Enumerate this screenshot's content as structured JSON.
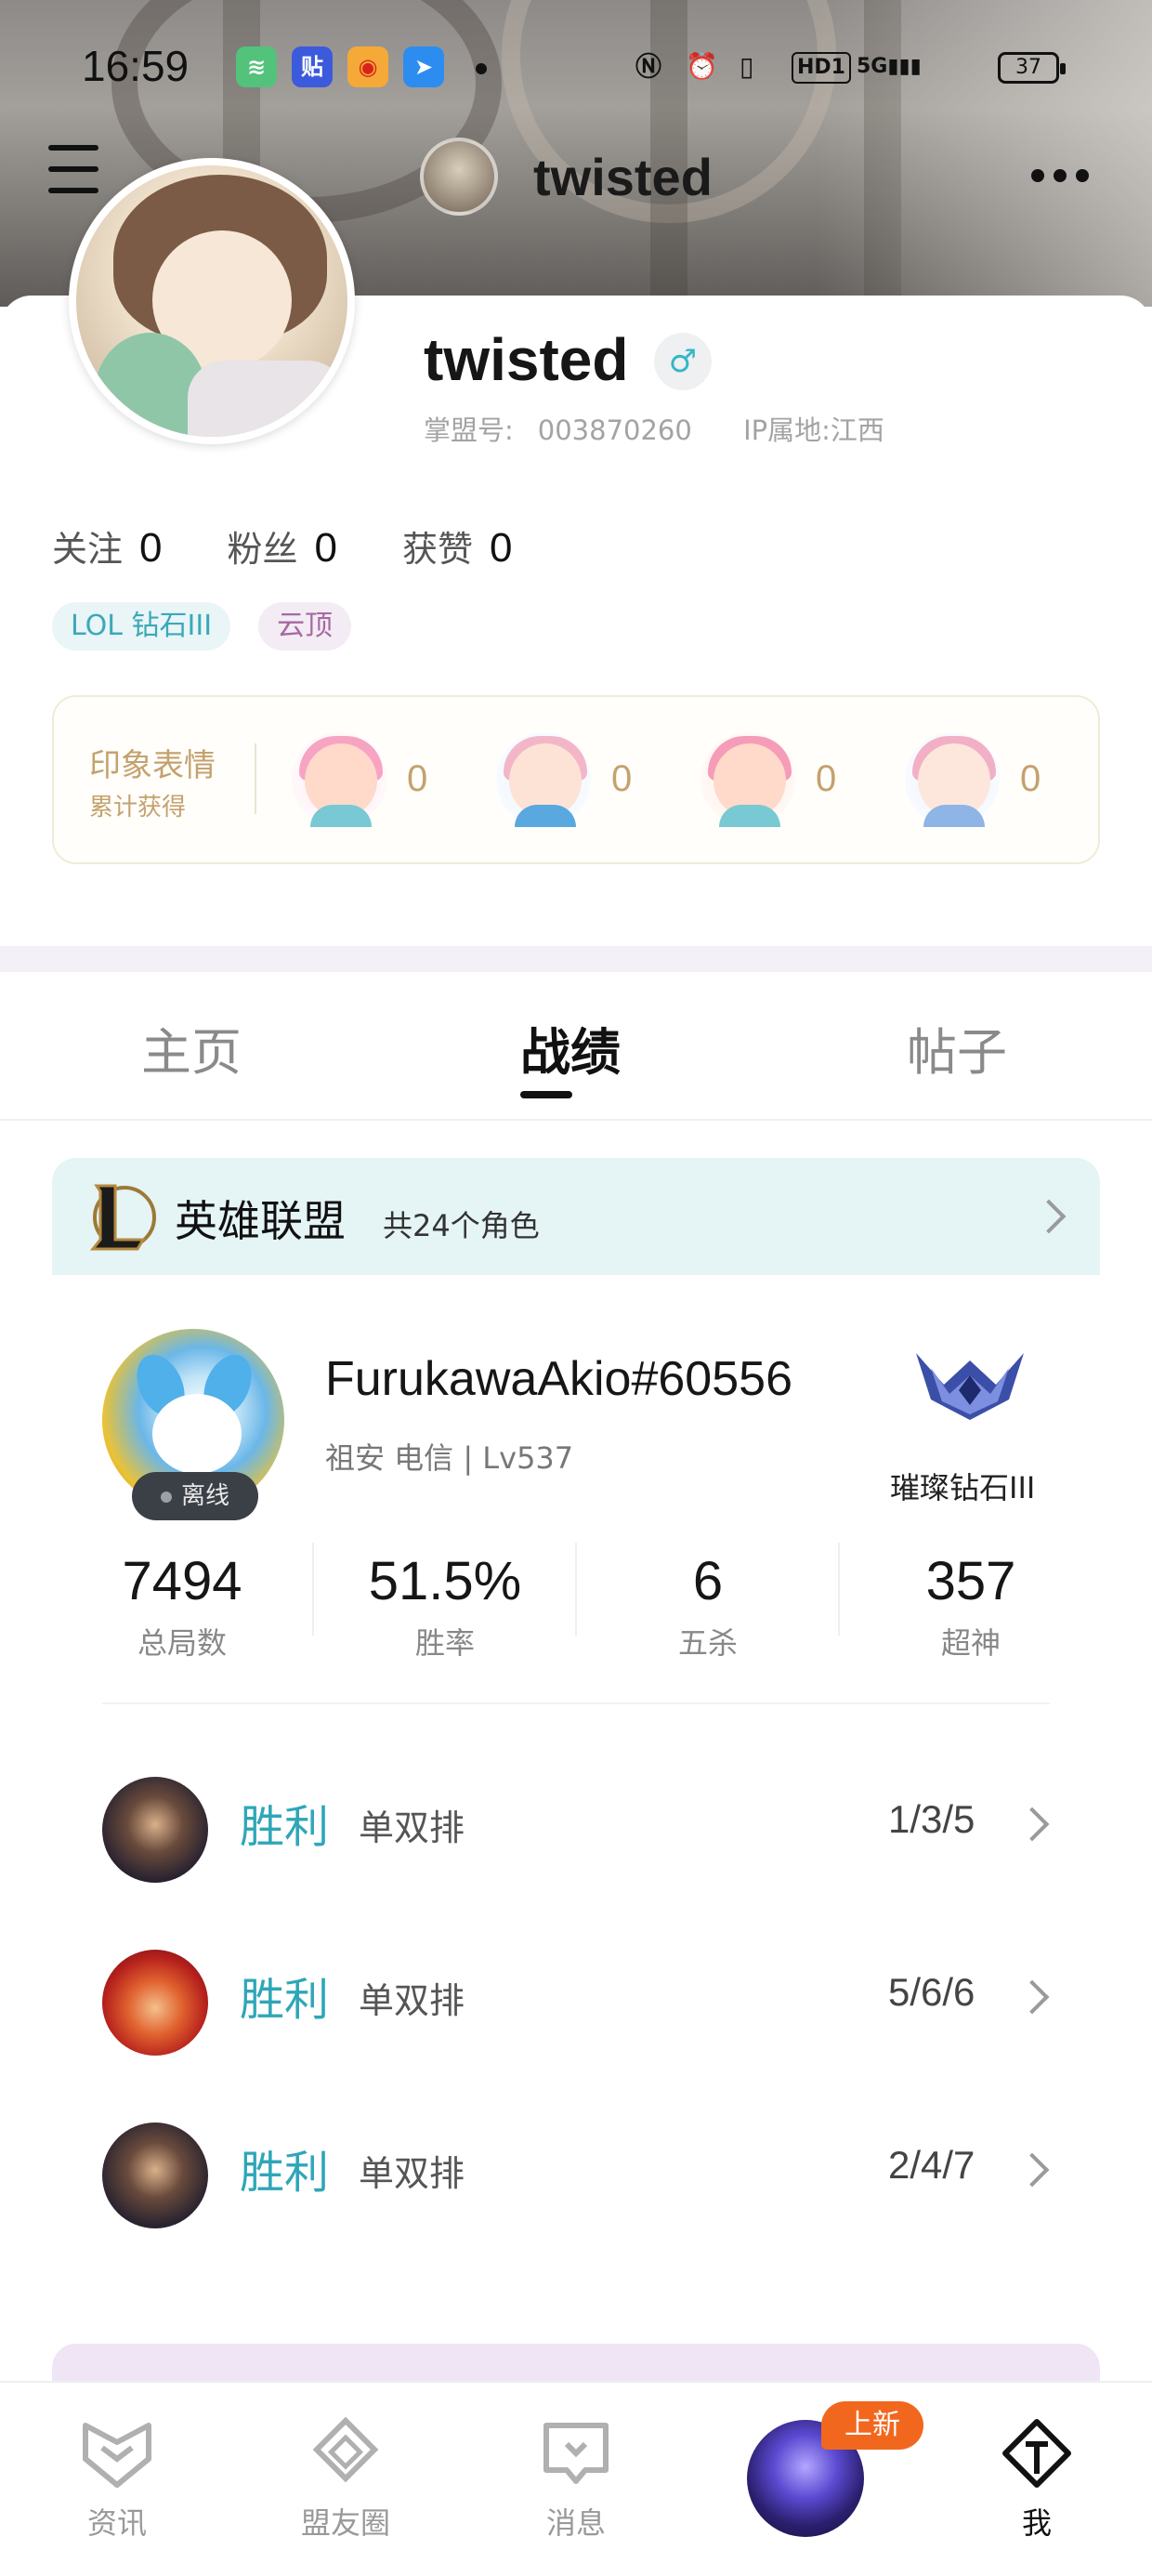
{
  "status_bar": {
    "time": "16:59",
    "battery": "37",
    "network": "5G",
    "hd_label": "HD1",
    "notif_icons": [
      "wifi-share-icon",
      "tieba-icon",
      "weibo-icon",
      "feishu-icon"
    ],
    "system_icons": [
      "nfc-icon",
      "alarm-icon",
      "vibrate-icon",
      "hd-icon",
      "signal-icon",
      "battery-icon"
    ]
  },
  "nav": {
    "title": "twisted",
    "menu_icon": "menu-icon",
    "more_icon": "more-dots-icon"
  },
  "profile": {
    "username": "twisted",
    "gender_symbol": "♂",
    "id_label": "掌盟号:",
    "id_value": "003870260",
    "ip_label": "IP属地:",
    "ip_value": "江西",
    "stats": [
      {
        "label": "关注",
        "value": "0"
      },
      {
        "label": "粉丝",
        "value": "0"
      },
      {
        "label": "获赞",
        "value": "0"
      }
    ],
    "tags": [
      "LOL 钻石III",
      "云顶"
    ]
  },
  "impressions": {
    "title": "印象表情",
    "subtitle": "累计获得",
    "items": [
      {
        "icon": "facepalm-emote-icon",
        "count": "0"
      },
      {
        "icon": "wave-emote-icon",
        "count": "0"
      },
      {
        "icon": "excited-emote-icon",
        "count": "0"
      },
      {
        "icon": "gg-emote-icon",
        "count": "0"
      }
    ]
  },
  "tabs": {
    "items": [
      "主页",
      "战绩",
      "帖子"
    ],
    "active": "战绩"
  },
  "game": {
    "name": "英雄联盟",
    "role_count": "共24个角色",
    "account": "FurukawaAkio#60556",
    "server": "祖安 电信 | Lv537",
    "status": "离线",
    "rank": "璀璨钻石III",
    "kpis": [
      {
        "value": "7494",
        "label": "总局数"
      },
      {
        "value": "51.5%",
        "label": "胜率"
      },
      {
        "value": "6",
        "label": "五杀"
      },
      {
        "value": "357",
        "label": "超神"
      }
    ]
  },
  "matches": [
    {
      "result": "胜利",
      "mode": "单双排",
      "kda": "1/3/5",
      "champion_icon": "twisted-fate-champion-icon"
    },
    {
      "result": "胜利",
      "mode": "单双排",
      "kda": "5/6/6",
      "champion_icon": "red-hair-champion-icon"
    },
    {
      "result": "胜利",
      "mode": "单双排",
      "kda": "2/4/7",
      "champion_icon": "twisted-fate-champion-icon"
    }
  ],
  "bottom_nav": {
    "items": [
      {
        "label": "资讯",
        "icon": "news-icon"
      },
      {
        "label": "盟友圈",
        "icon": "friends-circle-icon"
      },
      {
        "label": "消息",
        "icon": "message-icon"
      },
      {
        "label": "",
        "icon": "promo-champion-icon"
      },
      {
        "label": "我",
        "icon": "profile-me-icon"
      }
    ],
    "promo_badge": "上新",
    "active": "我"
  },
  "colors": {
    "accent_teal": "#2fa6b8",
    "gold": "#c4a26e",
    "badge_orange": "#f2671e",
    "game_header_bg": "#e5f4f5"
  }
}
